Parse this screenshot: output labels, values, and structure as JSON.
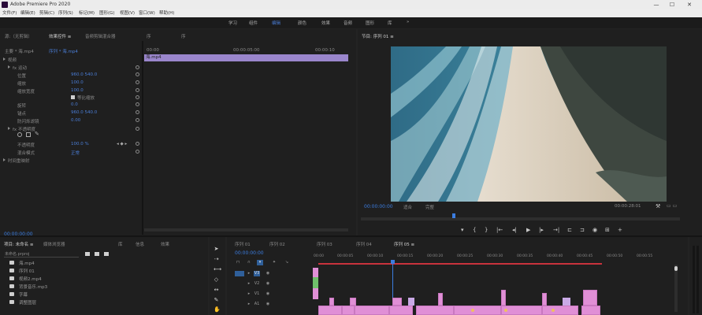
{
  "window": {
    "title": "Adobe Premiere Pro 2020",
    "minimize": "—",
    "maximize": "☐",
    "close": "✕"
  },
  "menu": [
    {
      "label": "文件(F)"
    },
    {
      "label": "编辑(E)"
    },
    {
      "label": "剪辑(C)"
    },
    {
      "label": "序列(S)"
    },
    {
      "label": "标记(M)"
    },
    {
      "label": "图形(G)"
    },
    {
      "label": "视图(V)"
    },
    {
      "label": "窗口(W)"
    },
    {
      "label": "帮助(H)"
    }
  ],
  "workspace": {
    "items": [
      {
        "label": "学习"
      },
      {
        "label": "组件"
      },
      {
        "label": "编辑"
      },
      {
        "label": "颜色"
      },
      {
        "label": "效果"
      },
      {
        "label": "音频"
      },
      {
        "label": "图形"
      },
      {
        "label": "库"
      },
      {
        "label": "»"
      }
    ],
    "active_index": 2
  },
  "effect_controls": {
    "tabs": [
      "源:（无剪辑）",
      "效果控件 ≡",
      "音频剪辑混合器",
      "元数据"
    ],
    "timeline_tab": "序",
    "timeline_tab_2": "序",
    "source_label": "主要 * 海.mp4",
    "sequence_label": "序列 * 海.mp4",
    "timecode_start": "00:00",
    "timecode_mid": "00:00:05:00",
    "timecode_end": "00:00:10",
    "clip_name": "海.mp4",
    "properties": [
      {
        "label": "视频",
        "value": ""
      },
      {
        "label": "fx 运动",
        "value": ""
      },
      {
        "label": "位置",
        "value": "960.0  540.0"
      },
      {
        "label": "缩放",
        "value": "100.0"
      },
      {
        "label": "缩放宽度",
        "value": "100.0"
      },
      {
        "label": "",
        "value": "等比缩放"
      },
      {
        "label": "旋转",
        "value": "0.0"
      },
      {
        "label": "锚点",
        "value": "960.0  540.0"
      },
      {
        "label": "防闪烁滤镜",
        "value": "0.00"
      },
      {
        "label": "fx 不透明度",
        "value": ""
      },
      {
        "label": "",
        "value": ""
      },
      {
        "label": "不透明度",
        "value": "100.0 %"
      },
      {
        "label": "混合模式",
        "value": "正常"
      },
      {
        "label": "时间重映射",
        "value": ""
      }
    ],
    "footer_timecode": "00:00:00:00"
  },
  "program_monitor": {
    "tab": "节目: 序列 01 ≡",
    "timecode": "00:00:00:00",
    "fit": "适合",
    "quality": "完整",
    "duration": "00:00:28:01",
    "controls": [
      "▾",
      "{",
      "}",
      "|←",
      "◂|",
      "▶",
      "|▸",
      "→|",
      "⊏",
      "⊐",
      "◉",
      "⊞",
      "+"
    ]
  },
  "project": {
    "tabs": [
      "项目: 未命名 ≡",
      "媒体浏览器",
      "库",
      "信息",
      "效果"
    ],
    "folder": "未命名.prproj",
    "items": [
      {
        "name": "海.mp4"
      },
      {
        "name": "序列 01"
      },
      {
        "name": "视频2.mp4"
      },
      {
        "name": "背景音乐.mp3"
      },
      {
        "name": "字幕"
      },
      {
        "name": "调整图层"
      }
    ]
  },
  "timeline": {
    "tabs": [
      "序列 01",
      "序列 02",
      "序列 03",
      "序列 04",
      "序列 05 ≡"
    ],
    "timecode": "00:00:00:00",
    "ruler": [
      "00:00",
      "00:00:05",
      "00:00:10",
      "00:00:15",
      "00:00:20",
      "00:00:25",
      "00:00:30",
      "00:00:35",
      "00:00:40",
      "00:00:45",
      "00:00:50",
      "00:00:55"
    ],
    "tracks": [
      "V3",
      "V2",
      "V1",
      "A1",
      "A2",
      "A3"
    ]
  },
  "colors": {
    "accent": "#3b7de0",
    "clip_audio": "#e08fd6",
    "clip_selected": "#9a86cc"
  }
}
